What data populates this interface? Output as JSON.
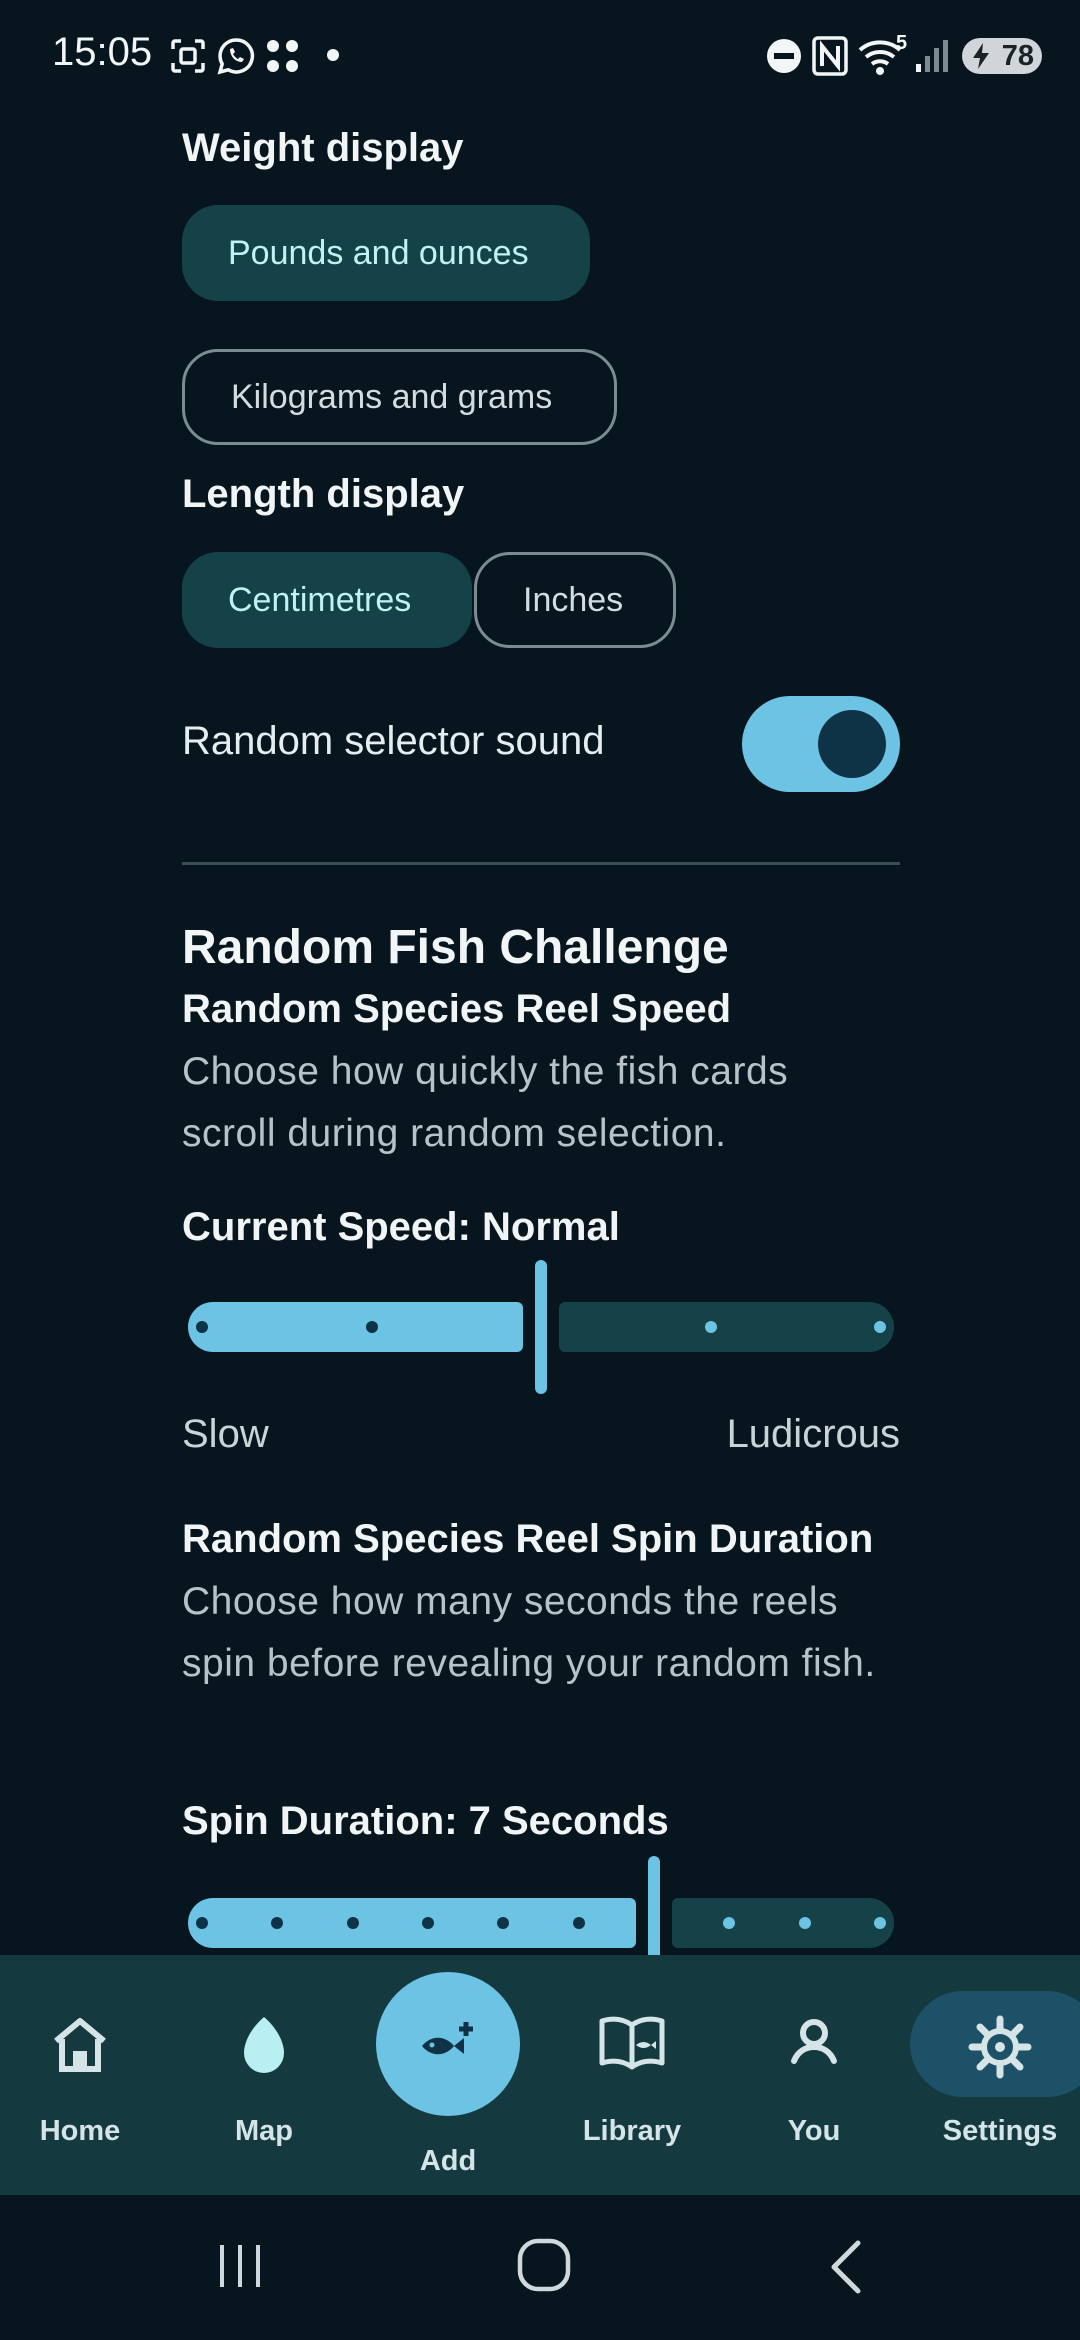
{
  "status_bar": {
    "time": "15:05",
    "battery": "78",
    "wifi_badge": "5",
    "icons": [
      "screenshot-icon",
      "whatsapp-icon",
      "apps-icon",
      "dot-icon",
      "do-not-disturb-icon",
      "nfc-icon",
      "wifi-icon",
      "signal-icon",
      "battery-icon"
    ]
  },
  "settings": {
    "weight_display": {
      "title": "Weight display",
      "options": [
        "Pounds and ounces",
        "Kilograms and grams"
      ],
      "selected": "Pounds and ounces"
    },
    "length_display": {
      "title": "Length display",
      "options": [
        "Centimetres",
        "Inches"
      ],
      "selected": "Centimetres"
    },
    "random_sound": {
      "label": "Random selector sound",
      "enabled": true
    }
  },
  "challenge": {
    "section_title": "Random Fish Challenge",
    "reel_speed": {
      "title": "Random Species Reel Speed",
      "description": "Choose how quickly the fish cards scroll during random selection.",
      "current": "Current Speed: Normal",
      "min_label": "Slow",
      "max_label": "Ludicrous",
      "steps": 5,
      "value_index": 2
    },
    "spin_duration": {
      "title": "Random Species Reel Spin Duration",
      "description": "Choose how many seconds the reels spin before revealing your random fish.",
      "current": "Spin Duration: 7 Seconds",
      "steps": 10,
      "value_index": 6
    }
  },
  "bottom_nav": {
    "items": [
      {
        "label": "Home",
        "icon": "home-icon"
      },
      {
        "label": "Map",
        "icon": "map-pin-icon"
      },
      {
        "label": "Add",
        "icon": "add-fish-icon"
      },
      {
        "label": "Library",
        "icon": "book-icon"
      },
      {
        "label": "You",
        "icon": "person-icon"
      },
      {
        "label": "Settings",
        "icon": "gear-icon"
      }
    ],
    "active": "Settings"
  },
  "colors": {
    "background": "#07161e",
    "accent": "#6cc3e3",
    "selected_pill": "#154248",
    "nav_bar": "#143a40"
  }
}
